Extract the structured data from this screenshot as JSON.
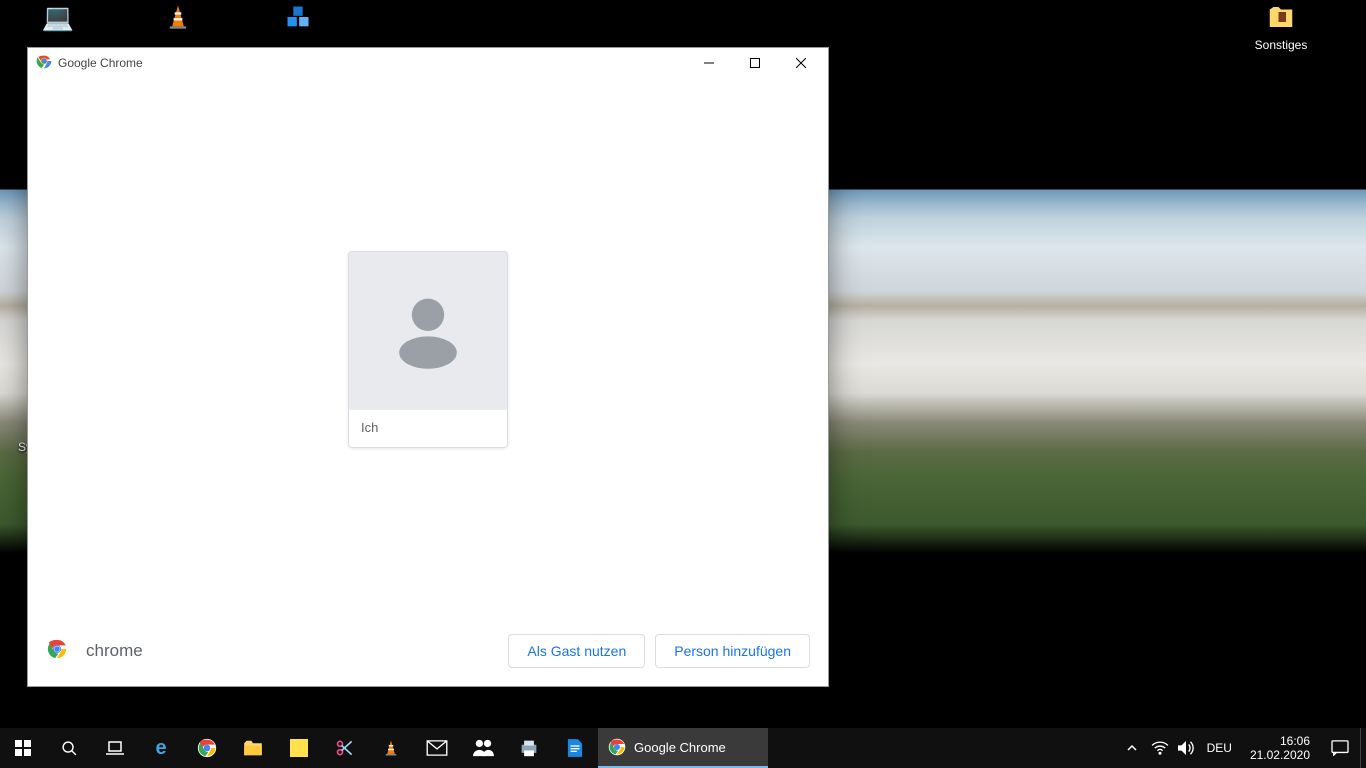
{
  "desktop": {
    "icons": {
      "sonstiges": "Sonstiges"
    },
    "partial_label_left": "Sy"
  },
  "window": {
    "title": "Google Chrome",
    "brand": "chrome",
    "profile_name": "Ich",
    "guest_button": "Als Gast nutzen",
    "add_person_button": "Person hinzufügen"
  },
  "taskbar": {
    "running_label": "Google Chrome",
    "language": "DEU",
    "time": "16:06",
    "date": "21.02.2020"
  }
}
